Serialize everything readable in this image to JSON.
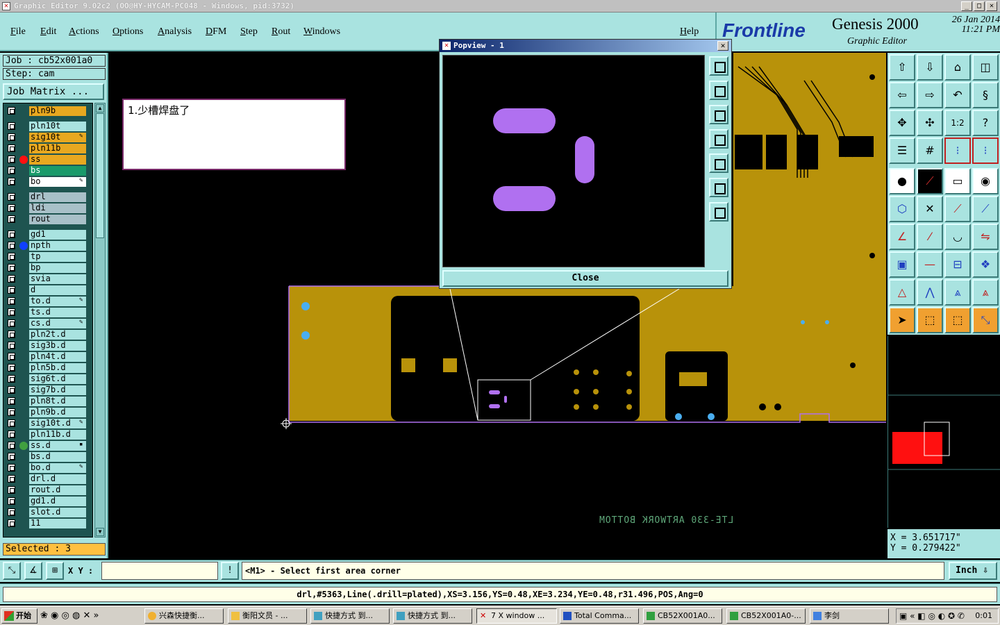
{
  "window": {
    "title": "Graphic Editor 9.02c2 (OO@HY-HYCAM-PC048 - Windows, pid:3732)"
  },
  "menu": {
    "items": [
      "File",
      "Edit",
      "Actions",
      "Options",
      "Analysis",
      "DFM",
      "Step",
      "Rout",
      "Windows"
    ],
    "help": "Help"
  },
  "brand": {
    "logo": "Frontline",
    "product": "Genesis 2000",
    "subtitle": "Graphic Editor",
    "date": "26 Jan 2014",
    "time": "11:21 PM"
  },
  "left_panel": {
    "job": "Job : cb52x001a0",
    "step": "Step: cam",
    "job_matrix": "Job Matrix ...",
    "selected": "Selected : 3",
    "layers": [
      {
        "name": "pln9b",
        "color": "#e8a820",
        "dot": ""
      },
      {
        "name": "pln10t",
        "color": "#a9e3e0",
        "dot": ""
      },
      {
        "name": "sig10t",
        "color": "#e8a820",
        "dot": "",
        "flag": "✎"
      },
      {
        "name": "pln11b",
        "color": "#e8a820",
        "dot": ""
      },
      {
        "name": "ss",
        "color": "#e8a820",
        "dot": "#ff1010"
      },
      {
        "name": "bs",
        "color": "#1a9a6a",
        "dot": ""
      },
      {
        "name": "bo",
        "color": "#ffffff",
        "dot": "",
        "flag": "✎"
      },
      {
        "name": "drl",
        "color": "#a8c0c8",
        "dot": ""
      },
      {
        "name": "ldi",
        "color": "#a8c0c8",
        "dot": ""
      },
      {
        "name": "rout",
        "color": "#a8c0c8",
        "dot": ""
      },
      {
        "name": "gd1",
        "color": "#a9e3e0",
        "dot": ""
      },
      {
        "name": "npth",
        "color": "#a9e3e0",
        "dot": "#1040ff"
      },
      {
        "name": "tp",
        "color": "#a9e3e0",
        "dot": ""
      },
      {
        "name": "bp",
        "color": "#a9e3e0",
        "dot": ""
      },
      {
        "name": "svia",
        "color": "#a9e3e0",
        "dot": ""
      },
      {
        "name": "d",
        "color": "#a9e3e0",
        "dot": ""
      },
      {
        "name": "to.d",
        "color": "#a9e3e0",
        "dot": "",
        "flag": "✎"
      },
      {
        "name": "ts.d",
        "color": "#a9e3e0",
        "dot": ""
      },
      {
        "name": "cs.d",
        "color": "#a9e3e0",
        "dot": "",
        "flag": "✎"
      },
      {
        "name": "pln2t.d",
        "color": "#a9e3e0",
        "dot": ""
      },
      {
        "name": "sig3b.d",
        "color": "#a9e3e0",
        "dot": ""
      },
      {
        "name": "pln4t.d",
        "color": "#a9e3e0",
        "dot": ""
      },
      {
        "name": "pln5b.d",
        "color": "#a9e3e0",
        "dot": ""
      },
      {
        "name": "sig6t.d",
        "color": "#a9e3e0",
        "dot": ""
      },
      {
        "name": "sig7b.d",
        "color": "#a9e3e0",
        "dot": ""
      },
      {
        "name": "pln8t.d",
        "color": "#a9e3e0",
        "dot": ""
      },
      {
        "name": "pln9b.d",
        "color": "#a9e3e0",
        "dot": ""
      },
      {
        "name": "sig10t.d",
        "color": "#a9e3e0",
        "dot": "",
        "flag": "✎"
      },
      {
        "name": "pln11b.d",
        "color": "#a9e3e0",
        "dot": ""
      },
      {
        "name": "ss.d",
        "color": "#a9e3e0",
        "dot": "#40a040",
        "flag": "▪"
      },
      {
        "name": "bs.d",
        "color": "#a9e3e0",
        "dot": ""
      },
      {
        "name": "bo.d",
        "color": "#a9e3e0",
        "dot": "",
        "flag": "✎"
      },
      {
        "name": "drl.d",
        "color": "#a9e3e0",
        "dot": ""
      },
      {
        "name": "rout.d",
        "color": "#a9e3e0",
        "dot": ""
      },
      {
        "name": "gd1.d",
        "color": "#a9e3e0",
        "dot": ""
      },
      {
        "name": "slot.d",
        "color": "#a9e3e0",
        "dot": ""
      },
      {
        "name": "11",
        "color": "#a9e3e0",
        "dot": ""
      }
    ]
  },
  "canvas": {
    "note": "1.少槽焊盘了",
    "artwork_text": "LTE-330 ARTWORK BOTTOM",
    "board_color": "#b8920a",
    "highlight_color": "#b070f0"
  },
  "popview": {
    "title": "Popview - 1",
    "close_label": "Close"
  },
  "coords": {
    "x": "X = 3.651717\"",
    "y": "Y = 0.279422\""
  },
  "command_bar": {
    "xy_label": "X Y :",
    "xy_value": "",
    "prompt": "<M1> - Select first area corner",
    "unit": "Inch"
  },
  "info": {
    "text": "drl,#5363,Line(.drill=plated),XS=3.156,YS=0.48,XE=3.234,YE=0.48,r31.496,POS,Ang=0"
  },
  "taskbar": {
    "start": "开始",
    "tasks": [
      "兴森快捷衡...",
      "衡阳文员 - ...",
      "快捷方式 到...",
      "快捷方式 到...",
      "7 X window ...",
      "Total Comma...",
      "CB52X001A0...",
      "CB52X001A0-...",
      "李剑"
    ],
    "clock": "0:01"
  }
}
